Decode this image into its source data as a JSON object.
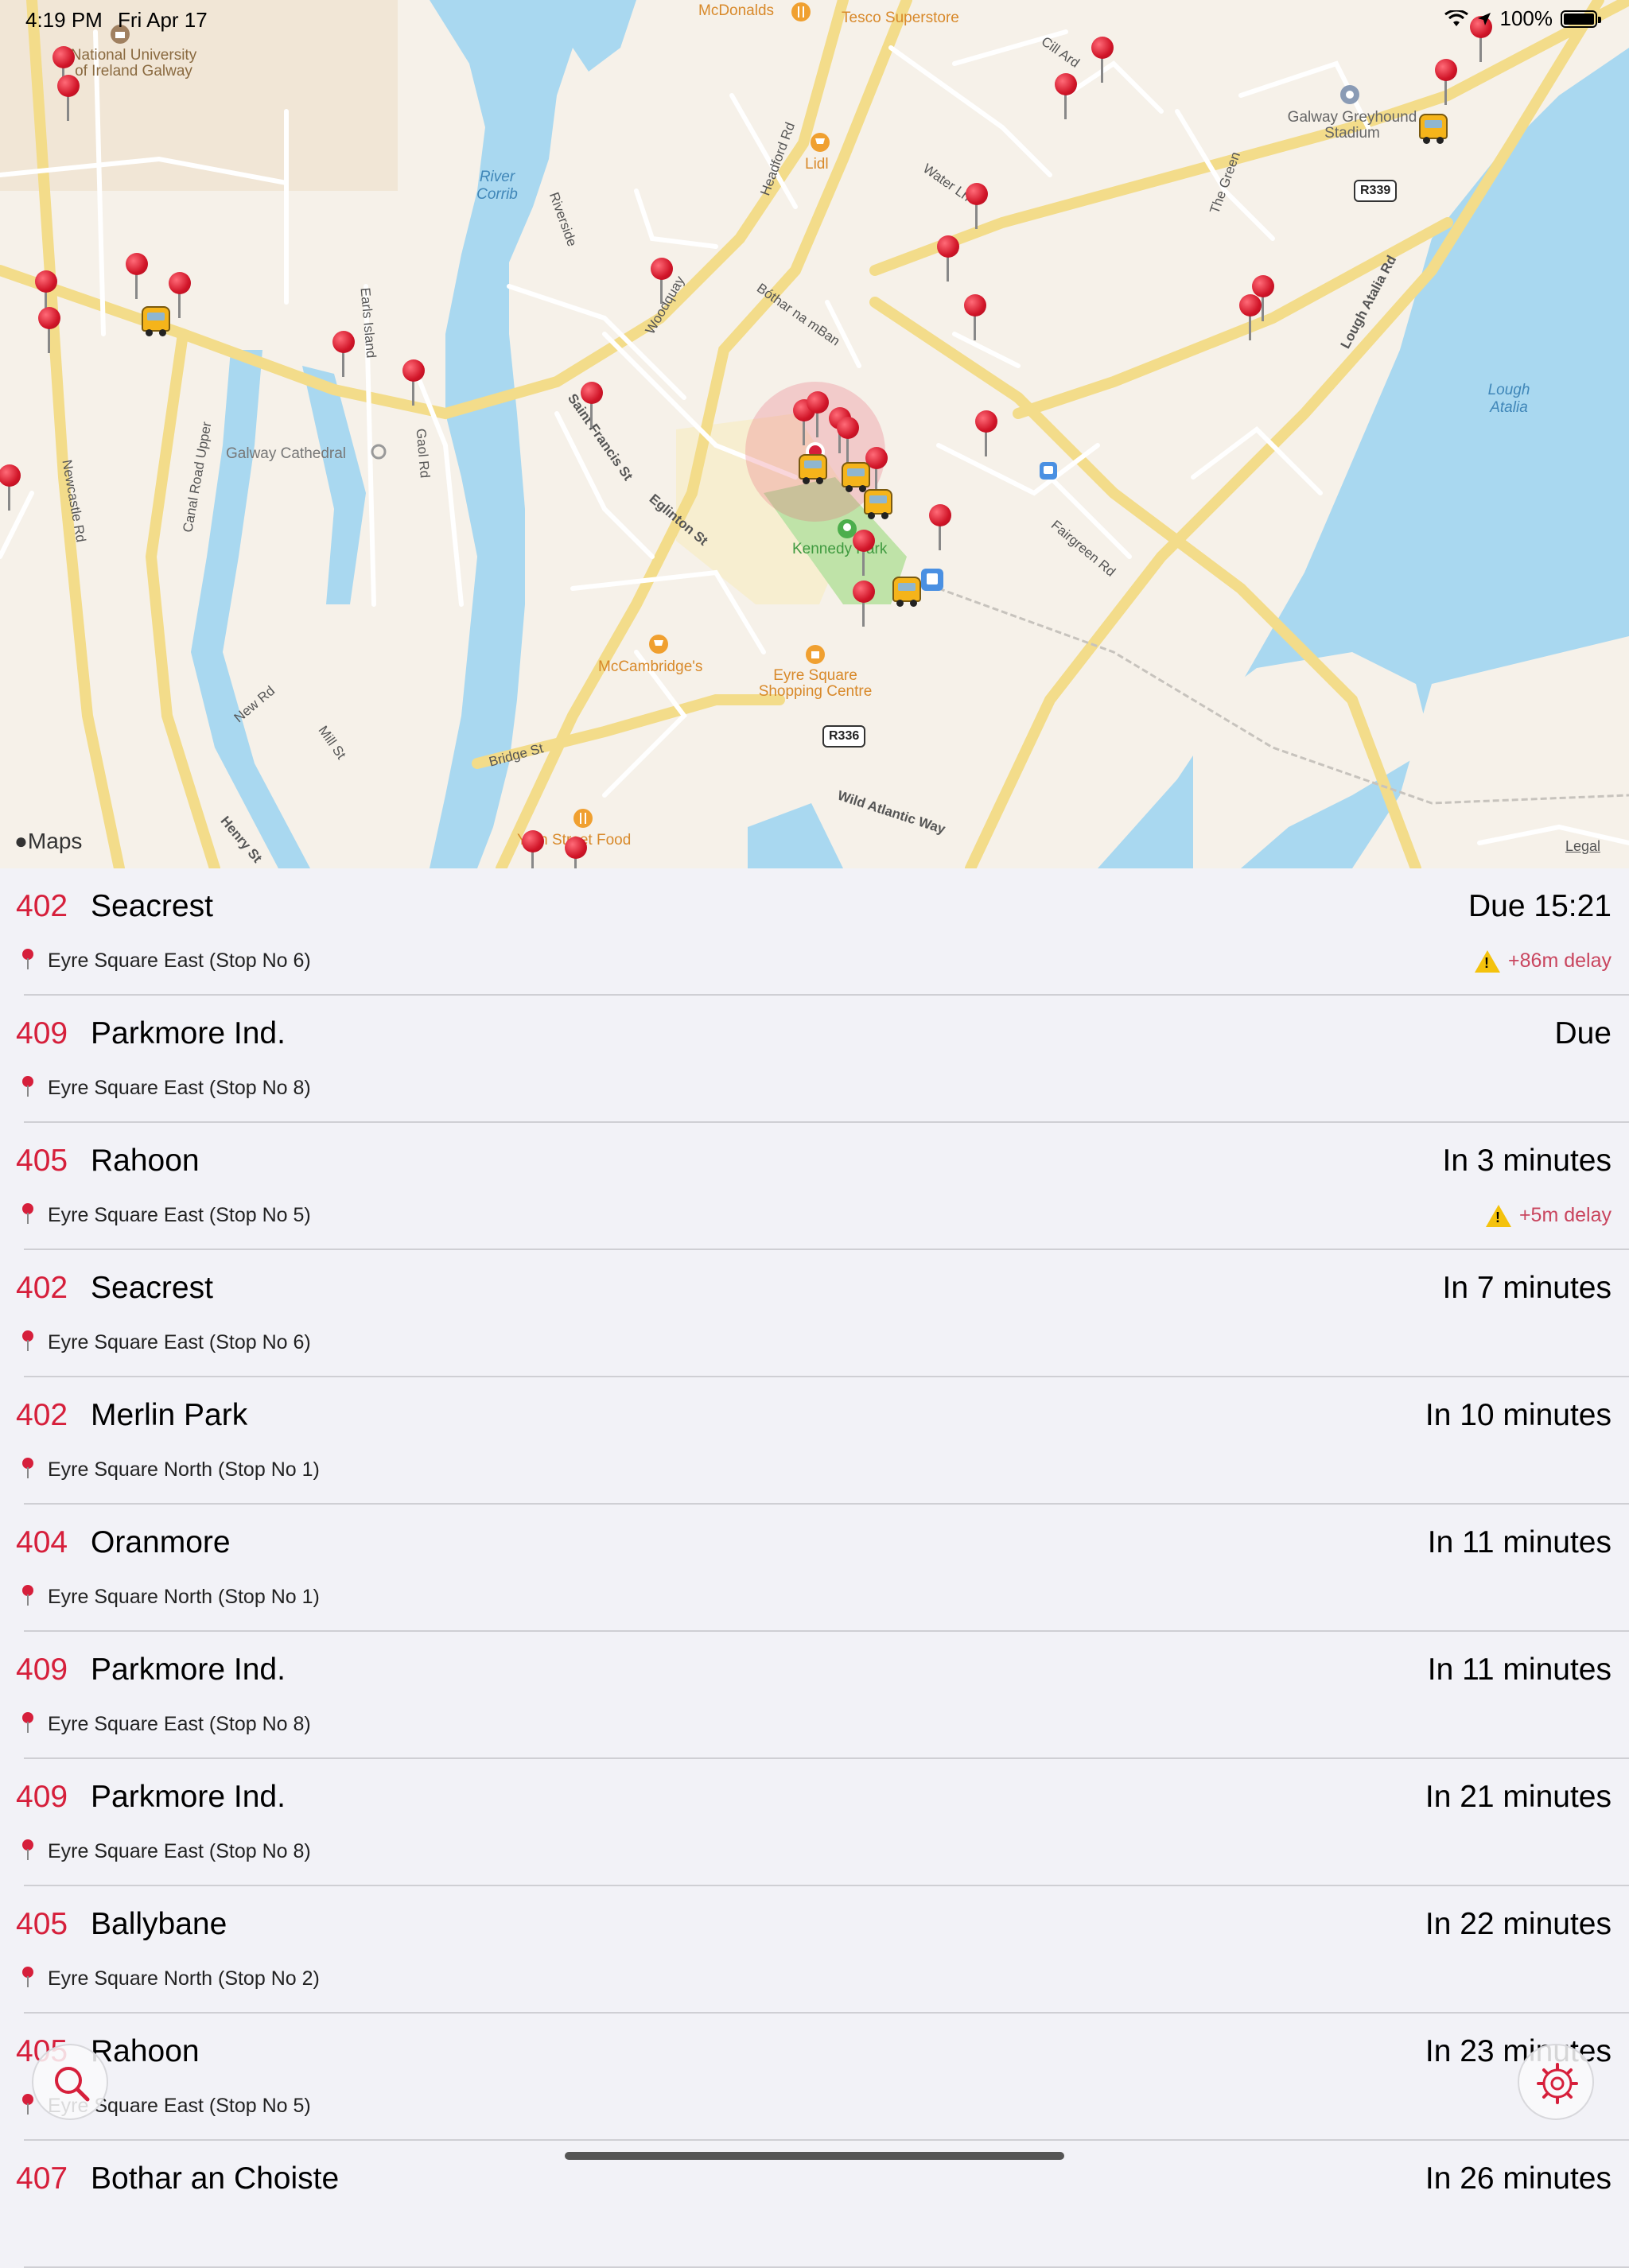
{
  "status_bar": {
    "time": "4:19 PM",
    "date": "Fri Apr 17",
    "battery": "100%"
  },
  "map": {
    "brand": "Maps",
    "legal": "Legal",
    "labels": {
      "nuig": "National University of Ireland Galway",
      "mcdonalds": "McDonalds",
      "tesco": "Tesco Superstore",
      "lidl": "Lidl",
      "river": "River Corrib",
      "greyhound": "Galway Greyhound Stadium",
      "cathedral": "Galway Cathedral",
      "kennedy": "Kennedy Park",
      "mccambridges": "McCambridge's",
      "eyre_centre": "Eyre Square Shopping Centre",
      "lough": "Lough Atalia",
      "yarn": "Yarn Street Food",
      "wild_atlantic": "Wild Atlantic Way",
      "lough_atalia_rd": "Lough Atalia Rd",
      "st_francis": "Saint Francis St",
      "eglinton": "Eglinton St",
      "headford": "Headford Rd",
      "bothar": "Bóthar na mBan",
      "newcastle": "Newcastle Rd",
      "canal_upper": "Canal Road Upper",
      "gaol": "Gaol Rd",
      "earls": "Earls Island",
      "riverside": "Riverside",
      "woodquay": "Woodquay",
      "new_rd": "New Rd",
      "mill": "Mill St",
      "bridge": "Bridge St",
      "henry": "Henry St",
      "fairgreen": "Fairgreen Rd",
      "water_ln": "Water Ln",
      "cill_ard": "Cill Ard",
      "the_green": "The Green",
      "r336": "R336",
      "r339": "R339"
    }
  },
  "departures": [
    {
      "route": "402",
      "destination": "Seacrest",
      "eta": "Due 15:21",
      "stop": "Eyre Square East (Stop No 6)",
      "delay": "+86m delay"
    },
    {
      "route": "409",
      "destination": "Parkmore Ind.",
      "eta": "Due",
      "stop": "Eyre Square East (Stop No 8)",
      "delay": ""
    },
    {
      "route": "405",
      "destination": "Rahoon",
      "eta": "In 3 minutes",
      "stop": "Eyre Square East (Stop No 5)",
      "delay": "+5m delay"
    },
    {
      "route": "402",
      "destination": "Seacrest",
      "eta": "In 7 minutes",
      "stop": "Eyre Square East (Stop No 6)",
      "delay": ""
    },
    {
      "route": "402",
      "destination": "Merlin Park",
      "eta": "In 10 minutes",
      "stop": "Eyre Square North (Stop No 1)",
      "delay": ""
    },
    {
      "route": "404",
      "destination": "Oranmore",
      "eta": "In 11 minutes",
      "stop": "Eyre Square North (Stop No 1)",
      "delay": ""
    },
    {
      "route": "409",
      "destination": "Parkmore Ind.",
      "eta": "In 11 minutes",
      "stop": "Eyre Square East (Stop No 8)",
      "delay": ""
    },
    {
      "route": "409",
      "destination": "Parkmore Ind.",
      "eta": "In 21 minutes",
      "stop": "Eyre Square East (Stop No 8)",
      "delay": ""
    },
    {
      "route": "405",
      "destination": "Ballybane",
      "eta": "In 22 minutes",
      "stop": "Eyre Square North (Stop No 2)",
      "delay": ""
    },
    {
      "route": "405",
      "destination": "Rahoon",
      "eta": "In 23 minutes",
      "stop": "Eyre Square East (Stop No 5)",
      "delay": ""
    },
    {
      "route": "407",
      "destination": "Bothar an Choiste",
      "eta": "In 26 minutes",
      "stop": "",
      "delay": ""
    }
  ],
  "buttons": {
    "search_icon": "search-icon",
    "settings_icon": "settings-icon"
  },
  "colors": {
    "accent": "#d61f3b",
    "water": "#a9d8f0",
    "map_bg": "#f6f1e9"
  }
}
